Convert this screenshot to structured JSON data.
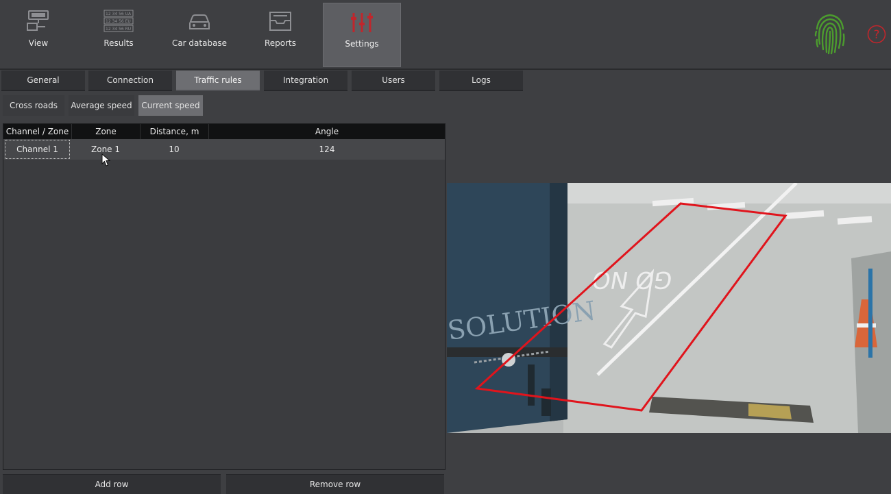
{
  "toolbar": {
    "items": [
      {
        "label": "View",
        "icon": "cctv-camera-icon"
      },
      {
        "label": "Results",
        "icon": "plate-list-icon"
      },
      {
        "label": "Car database",
        "icon": "car-icon"
      },
      {
        "label": "Reports",
        "icon": "inbox-tray-icon"
      },
      {
        "label": "Settings",
        "icon": "sliders-icon",
        "active": true
      }
    ],
    "results_icon_lines": [
      "12 34 56 UA",
      "12 34 56 EU",
      "12 34 56 RU"
    ],
    "fingerprint_icon": "fingerprint-icon",
    "help_icon": "question-circle-icon",
    "help_glyph": "?"
  },
  "tabs": [
    {
      "label": "General"
    },
    {
      "label": "Connection"
    },
    {
      "label": "Traffic rules",
      "active": true
    },
    {
      "label": "Integration"
    },
    {
      "label": "Users"
    },
    {
      "label": "Logs"
    }
  ],
  "subtabs": [
    {
      "label": "Cross roads"
    },
    {
      "label": "Average speed"
    },
    {
      "label": "Current speed",
      "active": true
    }
  ],
  "table": {
    "columns": [
      "Channel / Zone",
      "Zone",
      "Distance, m",
      "Angle"
    ],
    "rows": [
      {
        "channel": "Channel 1",
        "zone": "Zone 1",
        "distance": "10",
        "angle": "124"
      }
    ]
  },
  "buttons": {
    "add_row": "Add row",
    "remove_row": "Remove row"
  },
  "camera": {
    "truck_text": "SOLUTION",
    "road_text": "GO NO",
    "zone_color": "#e0141c"
  },
  "colors": {
    "accent_red": "#c0262c",
    "fingerprint_green": "#4c9c2e",
    "background": "#3e3f42"
  }
}
